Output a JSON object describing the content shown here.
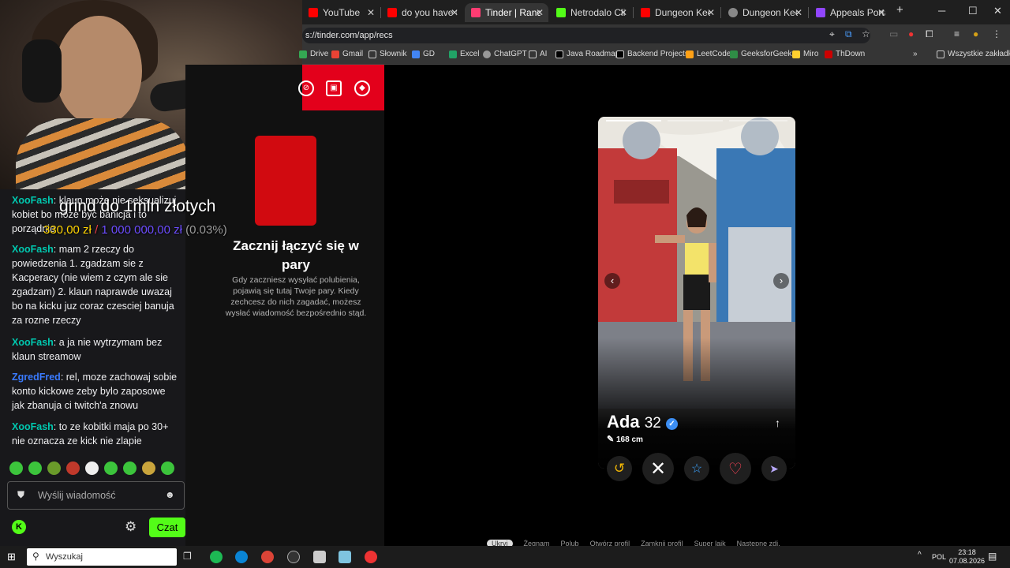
{
  "browser": {
    "tabs": [
      {
        "title": "YouTube",
        "color": "#ff0000"
      },
      {
        "title": "do you have to l",
        "color": "#ff0000"
      },
      {
        "title": "Tinder | Randki, p",
        "color": "#fe3c72",
        "active": true
      },
      {
        "title": "Netrodalo Clips",
        "color": "#53fc18"
      },
      {
        "title": "Dungeon Keeper",
        "color": "#ff0000"
      },
      {
        "title": "Dungeon Keeper",
        "color": "#888888"
      },
      {
        "title": "Appeals Portal",
        "color": "#9146ff"
      }
    ],
    "new_tab": "+",
    "url": "s://tinder.com/app/recs",
    "bookmarks": [
      "Drive",
      "Gmail",
      "Słownik",
      "GD",
      "Excel",
      "ChatGPT",
      "AI",
      "Java Roadmap",
      "Backend Projects",
      "LeetCode",
      "GeeksforGeeks",
      "Miro",
      "ThDown"
    ],
    "bookmarks_more": "»",
    "all_bookmarks": "Wszystkie zakładki"
  },
  "tinder": {
    "match_title": "Zacznij łączyć się w pary",
    "match_desc": "Gdy zaczniesz wysyłać polubienia, pojawią się tutaj Twoje pary. Kiedy zechcesz do nich zagadać, możesz wysłać wiadomość bezpośrednio stąd.",
    "profile": {
      "name": "Ada",
      "age": "32",
      "height": "168 cm"
    },
    "shortcuts": [
      "Ukryj",
      "Żegnam",
      "Polub",
      "Otwórz profil",
      "Zamknij profil",
      "Super lajk",
      "Następne zdj."
    ]
  },
  "overlay": {
    "goal_text": "grind do 1mln złotych",
    "current": "330,00 zł",
    "separator": "/",
    "target": "1 000 000,00 zł",
    "percent": "(0.03%)"
  },
  "chat": {
    "messages": [
      {
        "user": "XooFash",
        "color": "#00c8af",
        "text": ": klaun może nie seksualizuj kobiet bo może być banicja i to porządnie"
      },
      {
        "user": "XooFash",
        "color": "#00c8af",
        "text": ": mam 2 rzeczy do powiedzenia 1. zgadzam sie z Kacperacy (nie wiem z czym ale sie zgadzam) 2. klaun naprawde uwazaj bo na kicku juz coraz czesciej banuja za rozne rzeczy"
      },
      {
        "user": "XooFash",
        "color": "#00c8af",
        "text": ": a ja nie wytrzymam bez klaun streamow"
      },
      {
        "user": "ZgredFred",
        "color": "#3a7bff",
        "text": ": rel, moze zachowaj sobie konto kickowe zeby bylo zaposowe jak zbanuja ci twitch'a znowu"
      },
      {
        "user": "XooFash",
        "color": "#00c8af",
        "text": ": to ze kobitki maja po 30+ nie oznacza ze kick nie zlapie"
      }
    ],
    "placeholder": "Wyślij wiadomość",
    "send_label": "Czat"
  },
  "taskbar": {
    "search_label": "Wyszukaj",
    "lang": "POL",
    "time": "23:18",
    "date": "07.08.2026"
  }
}
